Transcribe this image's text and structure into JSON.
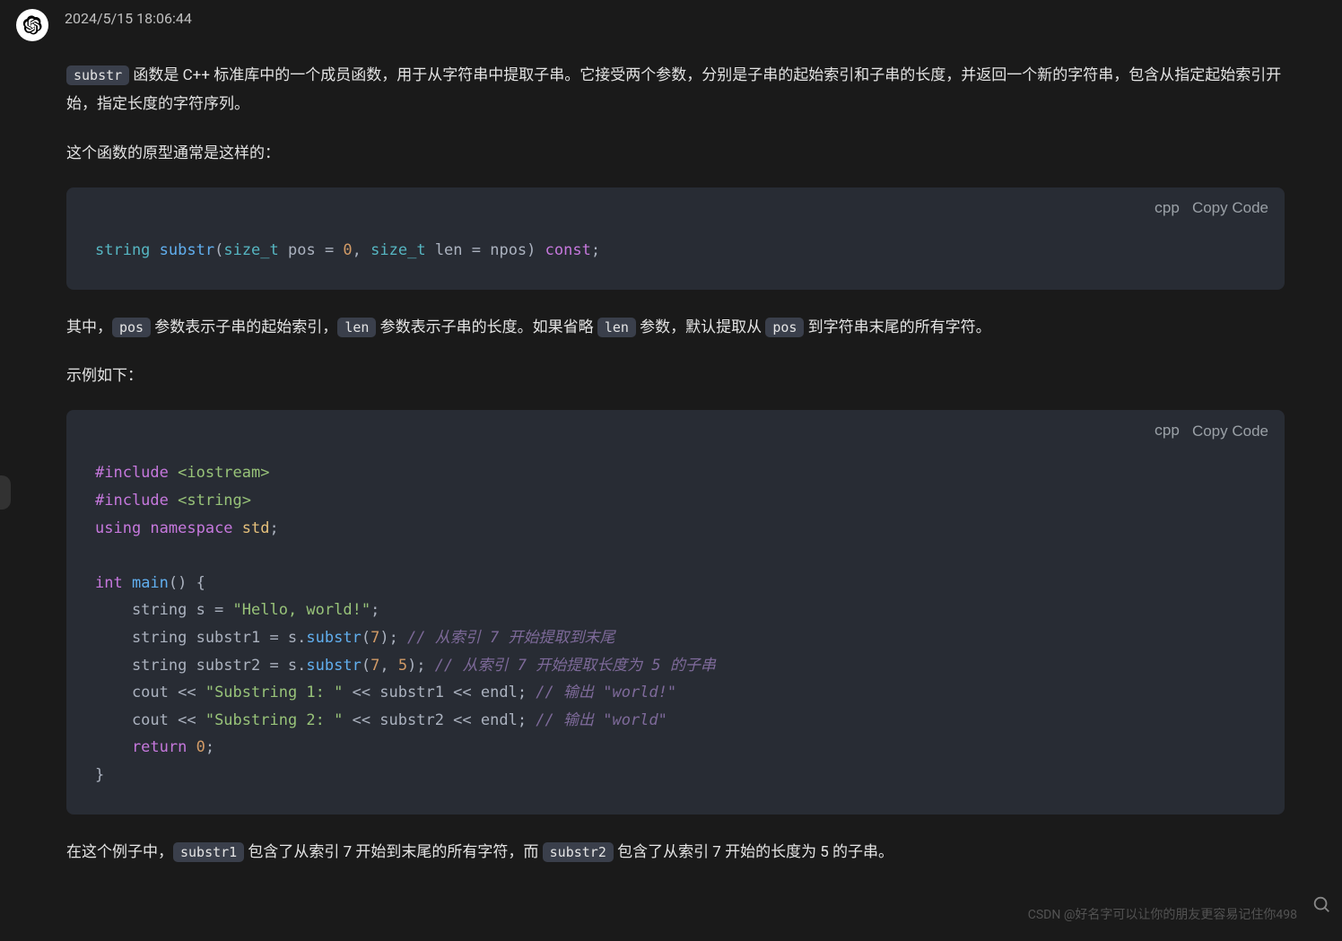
{
  "timestamp": "2024/5/15 18:06:44",
  "para1": {
    "code0": "substr",
    "t1": " 函数是 C++ 标准库中的一个成员函数，用于从字符串中提取子串。它接受两个参数，分别是子串的起始索引和子串的长度，并返回一个新的字符串，包含从指定起始索引开始，指定长度的字符序列。"
  },
  "para2": "这个函数的原型通常是这样的：",
  "codeblock1": {
    "lang": "cpp",
    "copy": "Copy Code",
    "tokens": {
      "t_string": "string",
      "t_substr": "substr",
      "t_open": "(",
      "t_sizet1": "size_t",
      "t_pos": " pos = ",
      "t_zero": "0",
      "t_comma": ", ",
      "t_sizet2": "size_t",
      "t_len": " len = npos",
      "t_close": ")",
      "t_const": " const",
      "t_semi": ";"
    }
  },
  "para3": {
    "t0": "其中，",
    "c0": "pos",
    "t1": " 参数表示子串的起始索引，",
    "c1": "len",
    "t2": " 参数表示子串的长度。如果省略 ",
    "c2": "len",
    "t3": " 参数，默认提取从 ",
    "c3": "pos",
    "t4": " 到字符串末尾的所有字符。"
  },
  "para4": "示例如下：",
  "codeblock2": {
    "lang": "cpp",
    "copy": "Copy Code",
    "lines": {
      "l1a": "#include",
      "l1b": " <iostream>",
      "l2a": "#include",
      "l2b": " <string>",
      "l3a": "using",
      "l3b": " namespace",
      "l3c": " std",
      "l3d": ";",
      "l5a": "int",
      "l5b": " main",
      "l5c": "() {",
      "l6a": "    string s = ",
      "l6b": "\"Hello, world!\"",
      "l6c": ";",
      "l7a": "    string substr1 = s.",
      "l7b": "substr",
      "l7c": "(",
      "l7d": "7",
      "l7e": "); ",
      "l7f": "// 从索引 7 开始提取到末尾",
      "l8a": "    string substr2 = s.",
      "l8b": "substr",
      "l8c": "(",
      "l8d": "7",
      "l8e": ", ",
      "l8f": "5",
      "l8g": "); ",
      "l8h": "// 从索引 7 开始提取长度为 5 的子串",
      "l9a": "    cout << ",
      "l9b": "\"Substring 1: \"",
      "l9c": " << substr1 << endl; ",
      "l9d": "// 输出 \"world!\"",
      "l10a": "    cout << ",
      "l10b": "\"Substring 2: \"",
      "l10c": " << substr2 << endl; ",
      "l10d": "// 输出 \"world\"",
      "l11a": "    return",
      "l11b": " 0",
      "l11c": ";",
      "l12": "}"
    }
  },
  "para5": {
    "t0": "在这个例子中，",
    "c0": "substr1",
    "t1": " 包含了从索引 7 开始到末尾的所有字符，而 ",
    "c1": "substr2",
    "t2": " 包含了从索引 7 开始的长度为 5 的子串。"
  },
  "watermark": "CSDN @好名字可以让你的朋友更容易记住你498"
}
